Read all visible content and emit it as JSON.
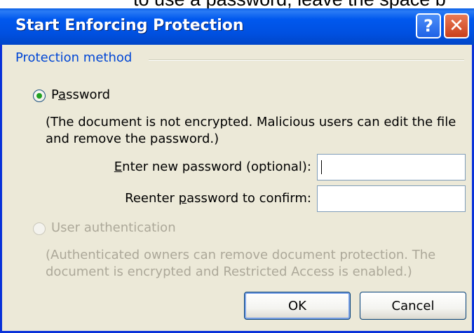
{
  "background_text": "to use a password, leave the space b",
  "dialog": {
    "title": "Start Enforcing Protection",
    "help_glyph": "?",
    "close_glyph": "✕",
    "group_label": "Protection method",
    "password_option": {
      "label_pre": "P",
      "label_underlined": "a",
      "label_post": "ssword",
      "selected": true,
      "description": "(The document is not encrypted. Malicious users can edit the file and remove the password.)"
    },
    "new_password": {
      "label_underlined": "E",
      "label_post": "nter new password (optional):",
      "value": ""
    },
    "confirm_password": {
      "label_pre": "Reenter ",
      "label_underlined": "p",
      "label_post": "assword to confirm:",
      "value": ""
    },
    "user_auth_option": {
      "label": "User authentication",
      "enabled": false,
      "description": "(Authenticated owners can remove document protection. The document is encrypted and Restricted Access is enabled.)"
    },
    "ok_label": "OK",
    "cancel_label": "Cancel"
  },
  "colors": {
    "titlebar": "#0058ee",
    "dialog_face": "#ece9d8",
    "group_label": "#0046d5",
    "disabled_text": "#aca899",
    "close_button": "#c9401c"
  }
}
